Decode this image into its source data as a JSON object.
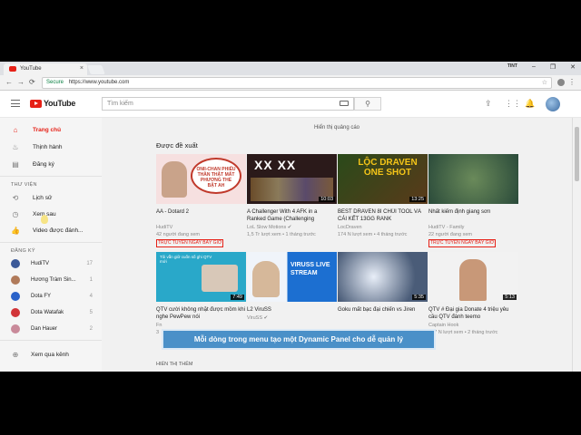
{
  "browser": {
    "tab_title": "YouTube",
    "tab_close": "×",
    "profile": "TINT",
    "win_min": "–",
    "win_max": "❐",
    "win_close": "✕",
    "back": "←",
    "forward": "→",
    "reload": "⟳",
    "secure": "Secure",
    "url": "https://www.youtube.com",
    "menu": "⋮",
    "star": "☆"
  },
  "header": {
    "logo_text": "YouTube",
    "search_placeholder": "Tìm kiếm",
    "search_icon": "⚲"
  },
  "sidebar": {
    "main_items": [
      {
        "label": "Trang chủ",
        "icon": "home-icon",
        "glyph": "⌂"
      },
      {
        "label": "Thịnh hành",
        "icon": "flame-icon",
        "glyph": "♨"
      },
      {
        "label": "Đăng ký",
        "icon": "subscriptions-icon",
        "glyph": "▤"
      }
    ],
    "library_heading": "THƯ VIỆN",
    "library_items": [
      {
        "label": "Lịch sử",
        "icon": "history-icon",
        "glyph": "⟲"
      },
      {
        "label": "Xem sau",
        "icon": "clock-icon",
        "glyph": "◷"
      },
      {
        "label": "Video được đánh...",
        "icon": "like-icon",
        "glyph": "👍"
      }
    ],
    "subs_heading": "ĐĂNG KÝ",
    "subs": [
      {
        "name": "HudiTV",
        "count": "17",
        "color": "#3b5998"
      },
      {
        "name": "Hương Tràm Sin...",
        "count": "1",
        "color": "#b07a5a"
      },
      {
        "name": "Dota FY",
        "count": "4",
        "color": "#2a62c9"
      },
      {
        "name": "Dota Watafak",
        "count": "5",
        "color": "#d13438"
      },
      {
        "name": "Dan Hauer",
        "count": "2",
        "color": "#c98a9a"
      }
    ],
    "browse_channels": "Xem qua kênh",
    "browse_glyph": "⊕"
  },
  "main": {
    "ad_note": "Hiển thị quảng cáo",
    "shelf_title": "Được đề xuất",
    "more_label": "HIỂN THỊ THÊM",
    "videos": [
      {
        "title": "AA - Dotard 2",
        "channel": "HudiTV",
        "meta": "42 người đang xem",
        "live": "TRỰC TUYẾN NGAY BÂY GIỜ",
        "duration": "",
        "thumb_text": "ONII-CHAN PHIẾU THẦN THẬT MẤT PHƯƠNG THỂ BẬT AH",
        "thumb_color": "#f3d6d6"
      },
      {
        "title": "A Challenger With 4 AFK in a Ranked Game (Challenging",
        "channel": "LoL Slow Motions ✔",
        "meta": "1,5 Tr lượt xem • 1 tháng trước",
        "live": "",
        "duration": "10:03",
        "thumb_text": "XX XX",
        "thumb_color": "#2b1a1a"
      },
      {
        "title": "BEST DRAVEN 8I CHỦI TOOL VÀ CÁI KẾT 13GG RANK",
        "channel": "LocDraven",
        "meta": "174 N lượt xem • 4 tháng trước",
        "live": "",
        "duration": "13:25",
        "thumb_text": "LỘC DRAVEN ONE SHOT",
        "thumb_color": "#3a2a18"
      },
      {
        "title": "Nhất kiếm định giang sơn",
        "channel": "HudiTV - Family",
        "meta": "22 người đang xem",
        "live": "TRỰC TUYẾN NGAY BÂY GIỜ",
        "duration": "",
        "thumb_text": "",
        "thumb_color": "#3f6b3a"
      },
      {
        "title": "QTV cười không nhặt được mồm khi nghe PewPew nói",
        "channel": "Fn",
        "meta": "3",
        "live": "",
        "duration": "7:49",
        "thumb_text": "Tôi vẫn giữ cuốn số ghi QTV mới",
        "thumb_color": "#29a8c9"
      },
      {
        "title": "L2 ViruSS",
        "channel": "ViruSS ✔",
        "meta": "",
        "live": "",
        "duration": "",
        "thumb_text": "VIRUSS LIVE STREAM",
        "thumb_color": "#1c6fd1"
      },
      {
        "title": "Goku mất bạc đại chiến vs Jiren",
        "channel": "",
        "meta": "",
        "live": "",
        "duration": "5:35",
        "thumb_text": "",
        "thumb_color": "#4a5c78"
      },
      {
        "title": "QTV # Đại gia Donate 4 triệu yêu cầu QTV đánh teemo",
        "channel": "Captain Hook",
        "meta": "157 N lượt xem • 2 tháng trước",
        "live": "",
        "duration": "5:13",
        "thumb_text": "",
        "thumb_color": "#e8e8e8"
      }
    ]
  },
  "caption": "Mỗi dòng trong menu tạo một Dynamic Panel cho dễ quản lý",
  "colors": {
    "accent": "#e62117",
    "caption_bg": "#4a90c8"
  }
}
